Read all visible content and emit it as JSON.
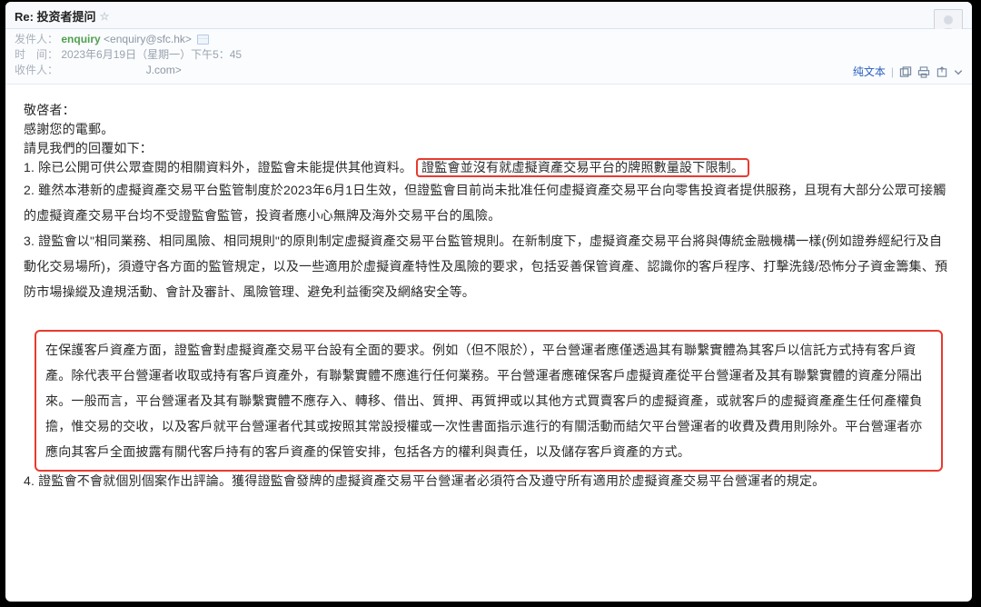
{
  "header": {
    "subject": "Re: 投资者提问"
  },
  "meta": {
    "from_label": "发件人：",
    "sender_name": "enquiry",
    "sender_addr": "<enquiry@sfc.hk>",
    "time_label": "时　间：",
    "time_value": "2023年6月19日（星期一）下午5：45",
    "to_label": "收件人：",
    "to_value_masked": "J.com>"
  },
  "toolbar": {
    "plaintext": "纯文本"
  },
  "body": {
    "salutation": "敬啓者：",
    "thanks": "感謝您的電郵。",
    "seebelow": "請見我們的回覆如下：",
    "item1_prefix": "1. 除已公開可供公眾查閱的相關資料外，證監會未能提供其他資料。",
    "item1_highlight": "證監會並沒有就虛擬資產交易平台的牌照數量設下限制。",
    "item2": "2. 雖然本港新的虛擬資產交易平台監管制度於2023年6月1日生效，但證監會目前尚未批准任何虛擬資產交易平台向零售投資者提供服務，且現有大部分公眾可接觸的虛擬資產交易平台均不受證監會監管，投資者應小心無牌及海外交易平台的風險。",
    "item3": "3. 證監會以\"相同業務、相同風險、相同規則\"的原則制定虛擬資產交易平台監管規則。在新制度下，虛擬資產交易平台將與傳統金融機構一樣(例如證券經紀行及自動化交易場所)，須遵守各方面的監管規定，以及一些適用於虛擬資產特性及風險的要求，包括妥善保管資產、認識你的客戶程序、打擊洗錢/恐怖分子資金籌集、預防市場操縱及違規活動、會計及審計、風險管理、避免利益衝突及網絡安全等。",
    "highlight_block": "在保護客戶資產方面，證監會對虛擬資產交易平台設有全面的要求。例如（但不限於），平台營運者應僅透過其有聯繫實體為其客戶以信託方式持有客戶資產。除代表平台營運者收取或持有客戶資產外，有聯繫實體不應進行任何業務。平台營運者應確保客戶虛擬資產從平台營運者及其有聯繫實體的資產分隔出來。一般而言，平台營運者及其有聯繫實體不應存入、轉移、借出、質押、再質押或以其他方式買賣客戶的虛擬資產，或就客戶的虛擬資產產生任何產權負擔，惟交易的交收，以及客戶就平台營運者代其或按照其常設授權或一次性書面指示進行的有關活動而結欠平台營運者的收費及費用則除外。平台營運者亦應向其客戶全面披露有關代客戶持有的客戶資產的保管安排，包括各方的權利與責任，以及儲存客戶資產的方式。",
    "item4": "4. 證監會不會就個別個案作出評論。獲得證監會發牌的虛擬資產交易平台營運者必須符合及遵守所有適用於虛擬資產交易平台營運者的規定。"
  }
}
